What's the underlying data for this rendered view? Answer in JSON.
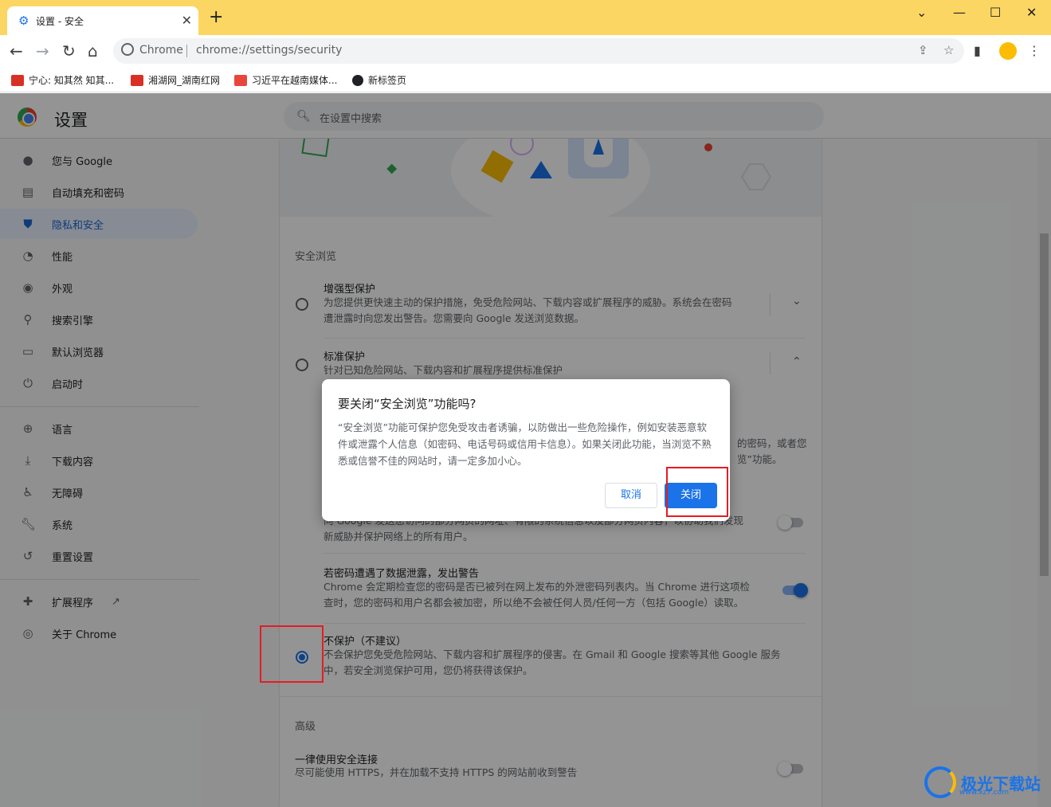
{
  "browser": {
    "tab_title": "设置 - 安全",
    "new_tab": "+",
    "omnibox_label": "Chrome",
    "url": "chrome://settings/security",
    "bookmarks": [
      "宁心: 知其然 知其...",
      "湘湖网_湖南红网",
      "习近平在越南媒体...",
      "新标签页"
    ]
  },
  "header": {
    "title": "设置",
    "search_placeholder": "在设置中搜索"
  },
  "sidebar": {
    "items": [
      {
        "label": "您与 Google",
        "icon": "person-icon"
      },
      {
        "label": "自动填充和密码",
        "icon": "clipboard-icon"
      },
      {
        "label": "隐私和安全",
        "icon": "shield-icon",
        "active": true
      },
      {
        "label": "性能",
        "icon": "speed-icon"
      },
      {
        "label": "外观",
        "icon": "palette-icon"
      },
      {
        "label": "搜索引擎",
        "icon": "search-icon"
      },
      {
        "label": "默认浏览器",
        "icon": "browser-icon"
      },
      {
        "label": "启动时",
        "icon": "power-icon"
      },
      {
        "label": "语言",
        "icon": "globe-icon"
      },
      {
        "label": "下载内容",
        "icon": "download-icon"
      },
      {
        "label": "无障碍",
        "icon": "accessibility-icon"
      },
      {
        "label": "系统",
        "icon": "wrench-icon"
      },
      {
        "label": "重置设置",
        "icon": "history-icon"
      },
      {
        "label": "扩展程序",
        "icon": "puzzle-icon"
      },
      {
        "label": "关于 Chrome",
        "icon": "chrome-icon"
      }
    ]
  },
  "main": {
    "safe_browsing_title": "安全浏览",
    "enhanced": {
      "title": "增强型保护",
      "desc1": "为您提供更快速主动的保护措施，免受危险网站、下载内容或扩展程序的威胁。系统会在密码",
      "desc2": "遭泄露时向您发出警告。您需要向 Google 发送浏览数据。"
    },
    "standard": {
      "title": "标准保护",
      "desc": "针对已知危险网站、下载内容和扩展程序提供标准保护"
    },
    "partial1": "的密码，或者您",
    "partial2": "览”功能。",
    "help_improve": {
      "desc1": "向 Google 发送您访问的部分网页的网址、有限的系统信息以及部分网页内容，以协助我们发现",
      "desc2": "新威胁并保护网络上的所有用户。"
    },
    "password_warn": {
      "title": "若密码遭遇了数据泄露，发出警告",
      "desc1": "Chrome 会定期检查您的密码是否已被列在网上发布的外泄密码列表内。当 Chrome 进行这项检",
      "desc2": "查时，您的密码和用户名都会被加密，所以绝不会被任何人员/任何一方（包括 Google）读取。"
    },
    "no_protection": {
      "title": "不保护（不建议）",
      "desc1": "不会保护您免受危险网站、下载内容和扩展程序的侵害。在 Gmail 和 Google 搜索等其他 Google 服务",
      "desc2": "中，若安全浏览保护可用，您仍将获得该保护。"
    },
    "advanced_title": "高级",
    "https": {
      "title": "一律使用安全连接",
      "desc": "尽可能使用 HTTPS，并在加载不支持 HTTPS 的网站前收到警告"
    }
  },
  "dialog": {
    "title": "要关闭“安全浏览”功能吗?",
    "body": "“安全浏览”功能可保护您免受攻击者诱骗，以防做出一些危险操作，例如安装恶意软件或泄露个人信息（如密码、电话号码或信用卡信息）。如果关闭此功能，当浏览不熟悉或信誉不佳的网站时，请一定多加小心。",
    "cancel": "取消",
    "confirm": "关闭"
  },
  "watermark": {
    "text": "极光下载站",
    "sub": "www.xz7.com"
  },
  "colors": {
    "titlebar": "#fbd663",
    "accent": "#1a73e8",
    "highlight": "#e51c23"
  }
}
